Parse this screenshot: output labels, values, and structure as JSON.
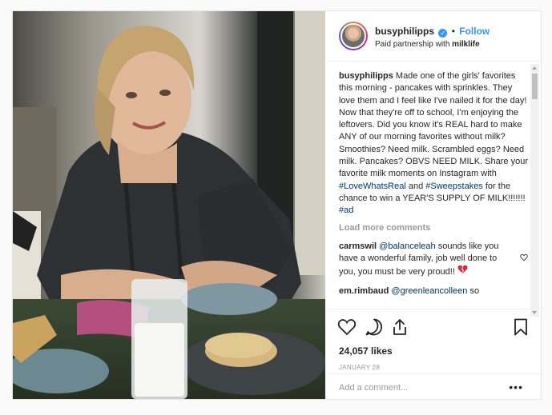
{
  "post": {
    "username": "busyphilipps",
    "verified_icon": "verified-badge-icon",
    "separator": "•",
    "follow_label": "Follow",
    "partnership_prefix": "Paid partnership with",
    "partner": "milklife"
  },
  "caption": {
    "username": "busyphilipps",
    "text_1": "Made one of the girls' favorites this morning - pancakes with sprinkles. They love them and I feel like I've nailed it for the day! Now that they're off to school, I'm enjoying the leftovers. Did you know it's REAL hard to make ANY of our morning favorites without milk? Smoothies? Need milk. Scrambled eggs? Need milk. Pancakes? OBVS NEED MILK. Share your favorite milk moments on Instagram with",
    "tag_1": "#LoveWhatsReal",
    "text_2": "and",
    "tag_2": "#Sweepstakes",
    "text_3": "for the chance to win a YEAR'S SUPPLY OF MILK!!!!!!!",
    "tag_3": "#ad"
  },
  "load_more_label": "Load more comments",
  "comments": [
    {
      "username": "carmswil",
      "mention": "@balanceleah",
      "text": "sounds like you have a wonderful family, job well done to you, you must be very proud!!",
      "emoji": "broken-heart-icon"
    },
    {
      "username": "em.rimbaud",
      "mention": "@greenleancolleen",
      "text": "so"
    }
  ],
  "likes": "24,057 likes",
  "date": "JANUARY 28",
  "add_comment_placeholder": "Add a comment...",
  "more_label": "•••",
  "colors": {
    "link": "#3897f0",
    "hashtag": "#003569",
    "muted": "#999999",
    "text": "#262626"
  }
}
